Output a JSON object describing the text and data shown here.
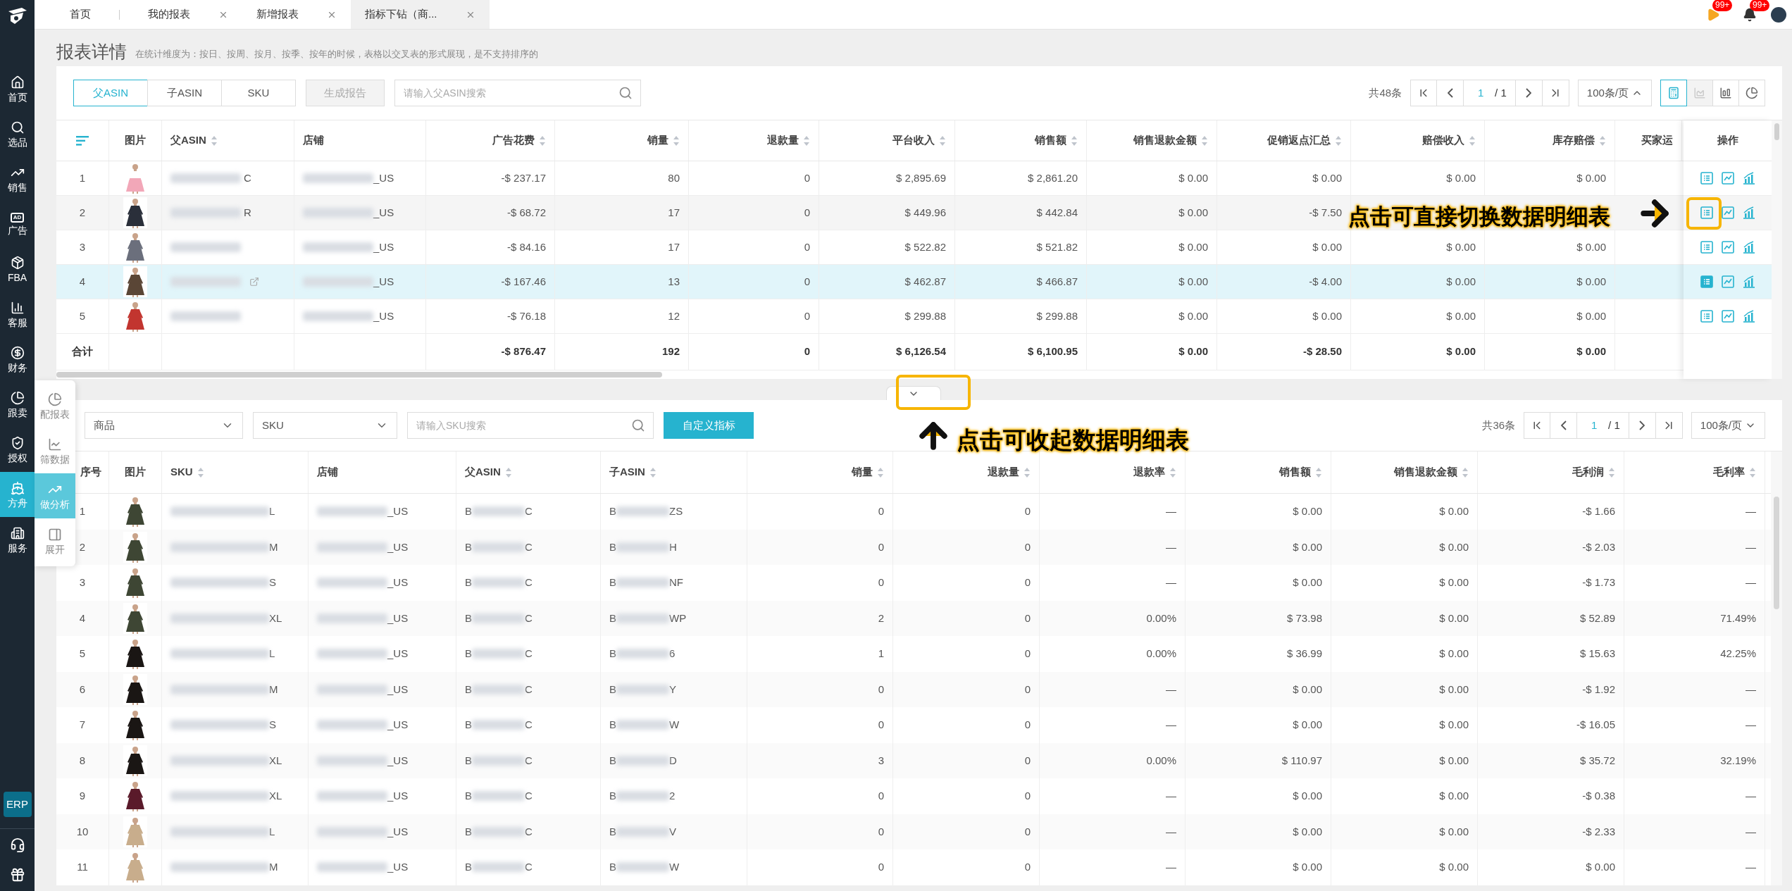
{
  "tabs": [
    {
      "label": "首页",
      "selected": false,
      "closable": false
    },
    {
      "label": "我的报表",
      "selected": false,
      "closable": true
    },
    {
      "label": "新增报表",
      "selected": false,
      "closable": true
    },
    {
      "label": "指标下钻（商...",
      "selected": true,
      "closable": true
    }
  ],
  "notifications": [
    {
      "badge": "99+"
    },
    {
      "badge": "99+"
    }
  ],
  "sidebar": {
    "items": [
      {
        "label": "首页",
        "selected": false
      },
      {
        "label": "选品",
        "selected": false
      },
      {
        "label": "销售",
        "selected": false
      },
      {
        "label": "广告",
        "selected": false,
        "icon_text": "AD"
      },
      {
        "label": "FBA",
        "selected": false
      },
      {
        "label": "客服",
        "selected": false
      },
      {
        "label": "财务",
        "selected": false
      },
      {
        "label": "跟卖",
        "selected": false
      },
      {
        "label": "授权",
        "selected": false
      },
      {
        "label": "方舟",
        "selected": true
      },
      {
        "label": "服务",
        "selected": false
      }
    ],
    "erp": "ERP"
  },
  "float_panel": {
    "items": [
      {
        "label": "配报表",
        "selected": false
      },
      {
        "label": "筛数据",
        "selected": false
      },
      {
        "label": "做分析",
        "selected": true
      },
      {
        "label": "展开",
        "selected": false
      }
    ]
  },
  "page": {
    "title": "报表详情",
    "hint": "在统计维度为：按日、按周、按月、按季、按年的时候，表格以交叉表的形式展现，是不支持排序的"
  },
  "top": {
    "view_tabs": [
      {
        "label": "父ASIN",
        "selected": true
      },
      {
        "label": "子ASIN",
        "selected": false
      },
      {
        "label": "SKU",
        "selected": false
      }
    ],
    "generate_button": {
      "label": "生成报告",
      "disabled": true
    },
    "search": {
      "placeholder": "请输入父ASIN搜索"
    },
    "total": "共48条",
    "page": "1",
    "pages": "/ 1",
    "page_size": "100条/页",
    "chart_views": [
      {
        "selected": true,
        "disabled": false
      },
      {
        "selected": false,
        "disabled": true
      },
      {
        "selected": false,
        "disabled": false
      },
      {
        "selected": false,
        "disabled": false
      }
    ],
    "columns": [
      {
        "label": "图片",
        "sortable": false
      },
      {
        "label": "父ASIN",
        "sortable": true
      },
      {
        "label": "店铺",
        "sortable": false
      },
      {
        "label": "广告花费",
        "sortable": true
      },
      {
        "label": "销量",
        "sortable": true
      },
      {
        "label": "退款量",
        "sortable": true
      },
      {
        "label": "平台收入",
        "sortable": true
      },
      {
        "label": "销售额",
        "sortable": true
      },
      {
        "label": "销售退款金额",
        "sortable": true
      },
      {
        "label": "促销返点汇总",
        "sortable": true
      },
      {
        "label": "赔偿收入",
        "sortable": true
      },
      {
        "label": "库存赔偿",
        "sortable": true
      },
      {
        "label": "买家运",
        "sortable": false
      }
    ],
    "ops_header": "操作",
    "rows": [
      {
        "index": "1",
        "parent_asin": "C",
        "shop": "_US",
        "link": false,
        "selected": false,
        "values": [
          "-$ 237.17",
          "80",
          "0",
          "$ 2,895.69",
          "$ 2,861.20",
          "$ 0.00",
          "$ 0.00",
          "$ 0.00",
          "$ 0.00"
        ]
      },
      {
        "index": "2",
        "parent_asin": "R",
        "shop": "_US",
        "link": false,
        "selected": false,
        "values": [
          "-$ 68.72",
          "17",
          "0",
          "$ 449.96",
          "$ 442.84",
          "$ 0.00",
          "-$ 7.50"
        ]
      },
      {
        "index": "3",
        "shop": "_US",
        "link": false,
        "selected": false,
        "values": [
          "-$ 84.16",
          "17",
          "0",
          "$ 522.82",
          "$ 521.82",
          "$ 0.00",
          "$ 0.00",
          "$ 0.00",
          "$ 0.00"
        ]
      },
      {
        "index": "4",
        "shop": "_US",
        "link": true,
        "selected": true,
        "values": [
          "-$ 167.46",
          "13",
          "0",
          "$ 462.87",
          "$ 466.87",
          "$ 0.00",
          "-$ 4.00",
          "$ 0.00",
          "$ 0.00"
        ]
      },
      {
        "index": "5",
        "shop": "_US",
        "link": false,
        "selected": false,
        "values": [
          "-$ 76.18",
          "12",
          "0",
          "$ 299.88",
          "$ 299.88",
          "$ 0.00",
          "$ 0.00",
          "$ 0.00",
          "$ 0.00"
        ]
      }
    ],
    "total_row": {
      "label": "合计",
      "values": [
        "-$ 876.47",
        "192",
        "0",
        "$ 6,126.54",
        "$ 6,100.95",
        "$ 0.00",
        "-$ 28.50",
        "$ 0.00",
        "$ 0.00"
      ]
    }
  },
  "bottom": {
    "selects": [
      {
        "value": "商品"
      },
      {
        "value": "SKU"
      }
    ],
    "search": {
      "placeholder": "请输入SKU搜索"
    },
    "custom_button": "自定义指标",
    "total": "共36条",
    "page": "1",
    "pages": "/ 1",
    "page_size": "100条/页",
    "columns": [
      {
        "label": "序号",
        "sortable": false
      },
      {
        "label": "图片",
        "sortable": false
      },
      {
        "label": "SKU",
        "sortable": true
      },
      {
        "label": "店铺",
        "sortable": false
      },
      {
        "label": "父ASIN",
        "sortable": true
      },
      {
        "label": "子ASIN",
        "sortable": true
      },
      {
        "label": "销量",
        "sortable": true
      },
      {
        "label": "退款量",
        "sortable": true
      },
      {
        "label": "退款率",
        "sortable": true
      },
      {
        "label": "销售额",
        "sortable": true
      },
      {
        "label": "销售退款金额",
        "sortable": true
      },
      {
        "label": "毛利润",
        "sortable": true
      },
      {
        "label": "毛利率",
        "sortable": true
      }
    ],
    "rows": [
      {
        "index": "1",
        "sku": "L",
        "shop": "_US",
        "parent_start": "B",
        "parent_end": "C",
        "child_start": "B",
        "child_end": "ZS",
        "values": [
          "0",
          "0",
          "—",
          "$ 0.00",
          "$ 0.00",
          "-$ 1.66",
          "—"
        ]
      },
      {
        "index": "2",
        "sku": "M",
        "shop": "_US",
        "parent_start": "B",
        "parent_end": "C",
        "child_start": "B",
        "child_end": "H",
        "values": [
          "0",
          "0",
          "—",
          "$ 0.00",
          "$ 0.00",
          "-$ 2.03",
          "—"
        ]
      },
      {
        "index": "3",
        "sku": "S",
        "shop": "_US",
        "parent_start": "B",
        "parent_end": "C",
        "child_start": "B",
        "child_end": "NF",
        "values": [
          "0",
          "0",
          "—",
          "$ 0.00",
          "$ 0.00",
          "-$ 1.73",
          "—"
        ]
      },
      {
        "index": "4",
        "sku": "XL",
        "shop": "_US",
        "parent_start": "B",
        "parent_end": "C",
        "child_start": "B",
        "child_end": "WP",
        "values": [
          "2",
          "0",
          "0.00%",
          "$ 73.98",
          "$ 0.00",
          "$ 52.89",
          "71.49%"
        ]
      },
      {
        "index": "5",
        "sku": "L",
        "shop": "_US",
        "parent_start": "B",
        "parent_end": "C",
        "child_start": "B",
        "child_end": "6",
        "values": [
          "1",
          "0",
          "0.00%",
          "$ 36.99",
          "$ 0.00",
          "$ 15.63",
          "42.25%"
        ]
      },
      {
        "index": "6",
        "sku": "M",
        "shop": "_US",
        "parent_start": "B",
        "parent_end": "C",
        "child_start": "B",
        "child_end": "Y",
        "values": [
          "0",
          "0",
          "—",
          "$ 0.00",
          "$ 0.00",
          "-$ 1.92",
          "—"
        ]
      },
      {
        "index": "7",
        "sku": "S",
        "shop": "_US",
        "parent_start": "B",
        "parent_end": "C",
        "child_start": "B",
        "child_end": "W",
        "values": [
          "0",
          "0",
          "—",
          "$ 0.00",
          "$ 0.00",
          "-$ 16.05",
          "—"
        ]
      },
      {
        "index": "8",
        "sku": "XL",
        "shop": "_US",
        "parent_start": "B",
        "parent_end": "C",
        "child_start": "B",
        "child_end": "D",
        "values": [
          "3",
          "0",
          "0.00%",
          "$ 110.97",
          "$ 0.00",
          "$ 35.72",
          "32.19%"
        ]
      },
      {
        "index": "9",
        "sku": "XL",
        "shop": "_US",
        "parent_start": "B",
        "parent_end": "C",
        "child_start": "B",
        "child_end": "2",
        "values": [
          "0",
          "0",
          "—",
          "$ 0.00",
          "$ 0.00",
          "-$ 0.38",
          "—"
        ]
      },
      {
        "index": "10",
        "sku": "L",
        "shop": "_US",
        "parent_start": "B",
        "parent_end": "C",
        "child_start": "B",
        "child_end": "V",
        "values": [
          "0",
          "0",
          "—",
          "$ 0.00",
          "$ 0.00",
          "-$ 2.33",
          "—"
        ]
      },
      {
        "index": "11",
        "sku": "M",
        "shop": "_US",
        "parent_start": "B",
        "parent_end": "C",
        "child_start": "B",
        "child_end": "W",
        "values": [
          "0",
          "0",
          "—",
          "$ 0.00",
          "$ 0.00",
          "$ 0.00",
          "—"
        ]
      }
    ]
  },
  "annotations": [
    {
      "text": "点击可直接切换数据明细表"
    },
    {
      "text": "点击可收起数据明细表"
    }
  ]
}
